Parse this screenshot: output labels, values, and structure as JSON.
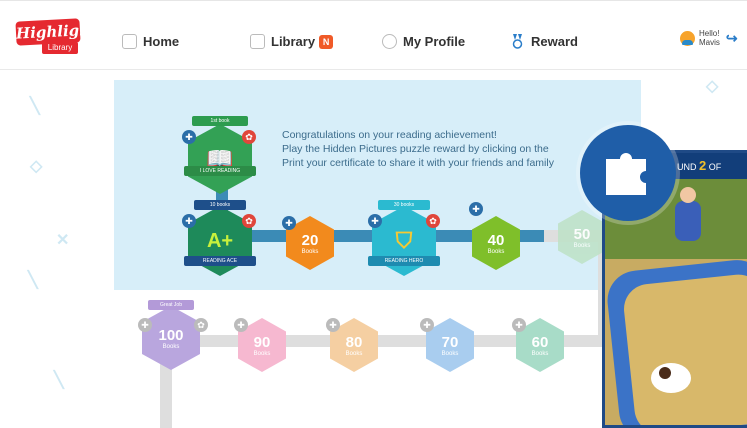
{
  "logo": {
    "brand": "Highlights",
    "sub": "Library"
  },
  "nav": {
    "home": "Home",
    "library": "Library",
    "library_badge": "N",
    "profile": "My Profile",
    "reward": "Reward"
  },
  "user": {
    "hello": "Hello!",
    "name": "Mavis"
  },
  "congrats": {
    "line1": "Congratulations on your reading achievement!",
    "line2": "Play the Hidden Pictures puzzle reward by clicking on the",
    "line3": "Print your certificate to share it with your friends and family"
  },
  "milestones": {
    "first_book": {
      "label": "1st book",
      "ribbon": "I LOVE READING"
    },
    "ten_books": {
      "label": "10 books",
      "badge": "A+",
      "ribbon": "READING ACE"
    },
    "twenty": {
      "number": "20",
      "sub": "Books"
    },
    "thirty_books": {
      "label": "30 books",
      "ribbon": "READING HERO"
    },
    "forty": {
      "number": "40",
      "sub": "Books"
    },
    "fifty": {
      "number": "50",
      "sub": "Books"
    },
    "hundred": {
      "number": "100",
      "sub": "Books",
      "label": "Great Job"
    },
    "ninety": {
      "number": "90",
      "sub": "Books"
    },
    "eighty": {
      "number": "80",
      "sub": "Books"
    },
    "seventy": {
      "number": "70",
      "sub": "Books"
    },
    "sixty": {
      "number": "60",
      "sub": "Books"
    }
  },
  "game": {
    "round_label": "UND",
    "round_current": "2",
    "round_of": "OF"
  },
  "colors": {
    "brand_red": "#e52930",
    "path_blue": "#3b8bb6",
    "sky": "#d7eef9",
    "puzzle_blue": "#1f5ea8"
  }
}
